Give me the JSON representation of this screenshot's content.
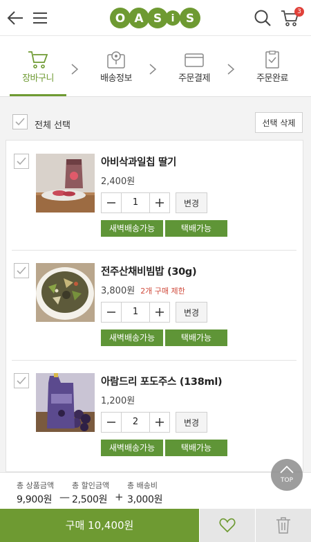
{
  "header": {
    "logo_text": "OASIS",
    "cart_count": "3",
    "icons": [
      "back-arrow-icon",
      "menu-icon",
      "search-icon",
      "cart-icon"
    ]
  },
  "steps": [
    {
      "label": "장바구니",
      "icon": "cart-icon",
      "active": true
    },
    {
      "label": "배송정보",
      "icon": "map-pin-icon",
      "active": false
    },
    {
      "label": "주문결제",
      "icon": "card-icon",
      "active": false
    },
    {
      "label": "주문완료",
      "icon": "clipboard-check-icon",
      "active": false
    }
  ],
  "selection": {
    "select_all_label": "전체 선택",
    "delete_selected_label": "선택 삭제"
  },
  "items": [
    {
      "name": "아비삭과일칩 딸기",
      "price": "2,400원",
      "limit": "",
      "qty": "1",
      "change_label": "변경",
      "tags": [
        "새벽배송가능",
        "택배가능"
      ],
      "image": "strawberry-chips-photo"
    },
    {
      "name": "전주산채비빔밥 (30g)",
      "price": "3,800원",
      "limit": "2개 구매 제한",
      "qty": "1",
      "change_label": "변경",
      "tags": [
        "새벽배송가능",
        "택배가능"
      ],
      "image": "bibimbap-photo"
    },
    {
      "name": "아람드리 포도주스 (138ml)",
      "price": "1,200원",
      "limit": "",
      "qty": "2",
      "change_label": "변경",
      "tags": [
        "새벽배송가능",
        "택배가능"
      ],
      "image": "grape-juice-photo"
    }
  ],
  "totals": {
    "product_label": "총 상품금액",
    "product_value": "9,900원",
    "discount_label": "총 할인금액",
    "discount_value": "2,500원",
    "shipping_label": "총 배송비",
    "shipping_value": "3,000원",
    "minus_sign": "—",
    "plus_sign": "+"
  },
  "top_button": "TOP",
  "bottom": {
    "buy_label": "구매 10,400원"
  },
  "colors": {
    "brand_green": "#6e9a32",
    "tag_green": "#5f9537",
    "limit_red": "#d04a3b",
    "badge_red": "#e0413a"
  }
}
